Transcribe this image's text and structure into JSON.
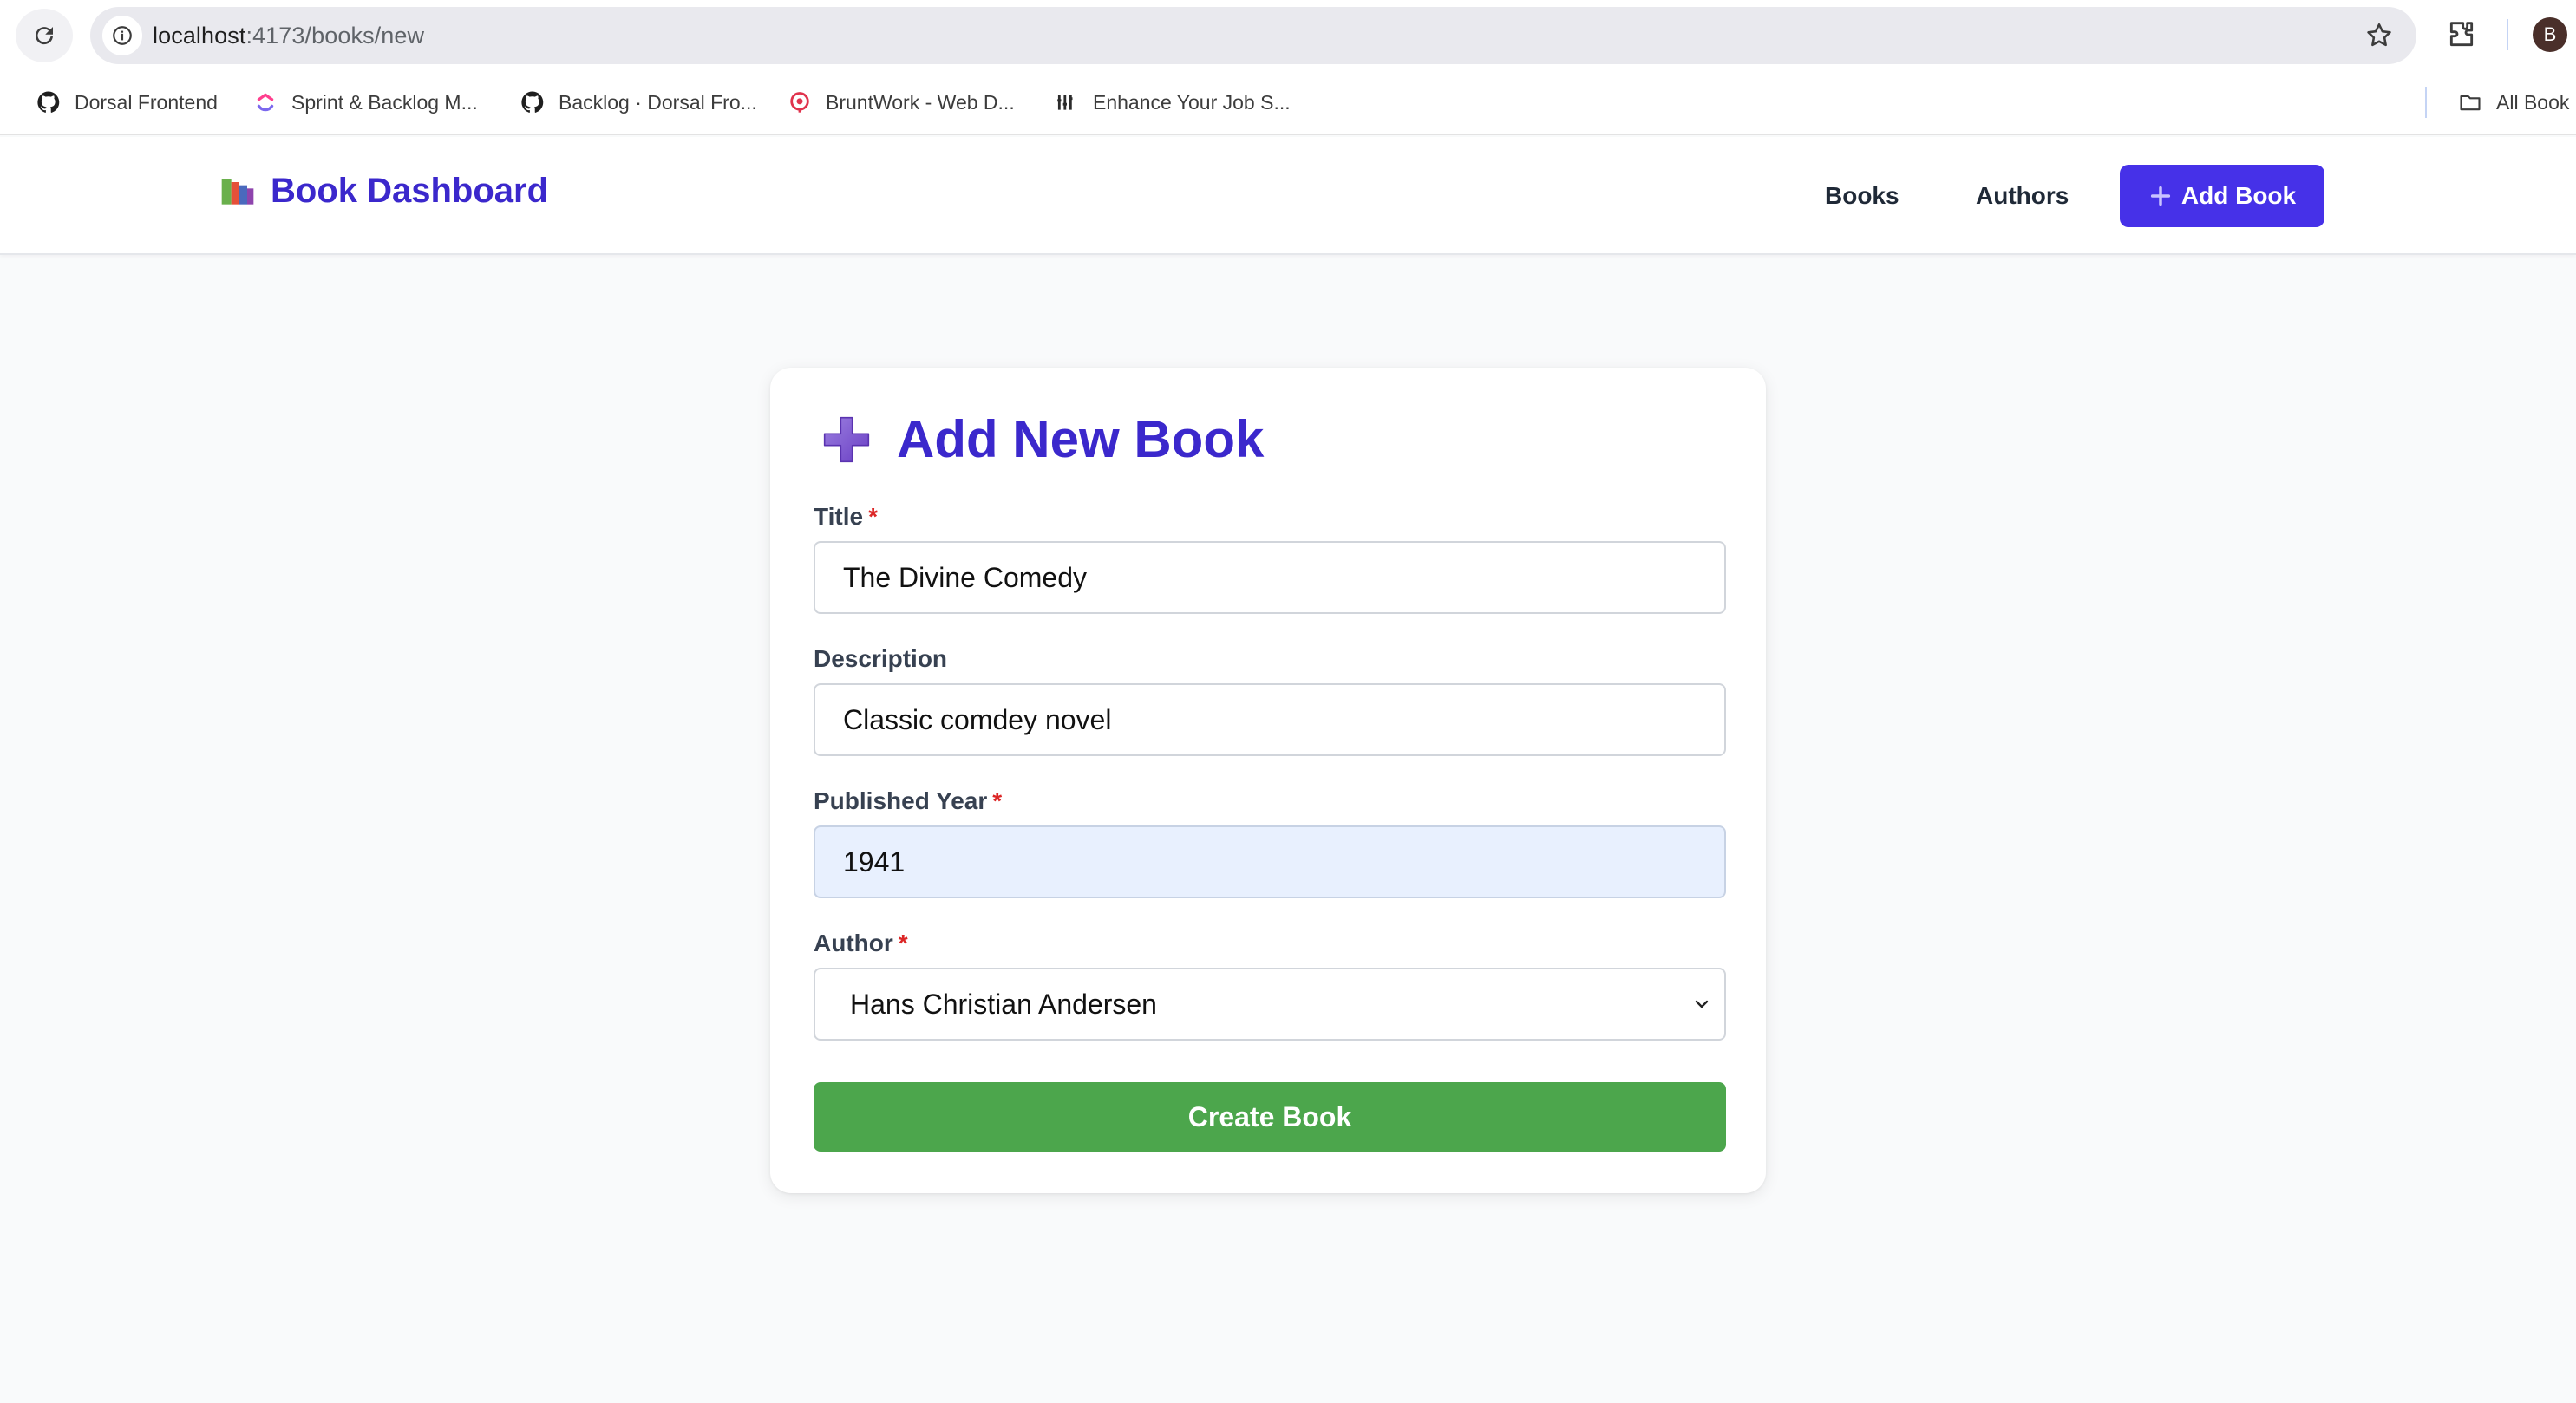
{
  "browser": {
    "url_host": "localhost",
    "url_path": ":4173/books/new",
    "profile_initial": "B",
    "bookmarks": [
      {
        "label": "Dorsal Frontend",
        "icon": "github-icon"
      },
      {
        "label": "Sprint & Backlog M...",
        "icon": "clickup-icon"
      },
      {
        "label": "Backlog · Dorsal Fro...",
        "icon": "github-icon"
      },
      {
        "label": "BruntWork - Web D...",
        "icon": "bruntwork-icon"
      },
      {
        "label": "Enhance Your Job S...",
        "icon": "enhance-icon"
      }
    ],
    "all_bookmarks": "All Book"
  },
  "nav": {
    "brand": "Book Dashboard",
    "brand_icon": "books-icon",
    "links": [
      "Books",
      "Authors"
    ],
    "add_button": "Add Book"
  },
  "form": {
    "title": "Add New Book",
    "fields": {
      "title": {
        "label": "Title",
        "required": "*",
        "value": "The Divine Comedy"
      },
      "description": {
        "label": "Description",
        "value": "Classic comdey novel"
      },
      "published_year": {
        "label": "Published Year",
        "required": "*",
        "value": "1941"
      },
      "author": {
        "label": "Author",
        "required": "*",
        "value": "Hans Christian Andersen"
      }
    },
    "submit": "Create Book"
  },
  "colors": {
    "accent": "#4631e8",
    "brand_text": "#3b28cc",
    "submit_green": "#4ca64c",
    "required_red": "#dc2626"
  }
}
